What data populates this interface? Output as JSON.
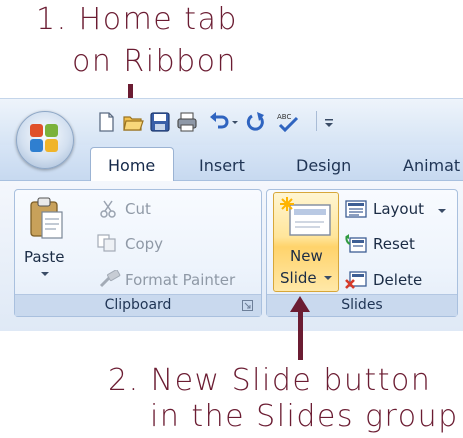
{
  "annotations": {
    "step1_line1": "1. Home tab",
    "step1_line2": "on Ribbon",
    "step2_line1": "2. New Slide button",
    "step2_line2": "in the Slides group"
  },
  "ribbon_tabs": [
    "Home",
    "Insert",
    "Design",
    "Animat"
  ],
  "clipboard_group": {
    "label": "Clipboard",
    "paste": "Paste",
    "cut": "Cut",
    "copy": "Copy",
    "format_painter": "Format Painter"
  },
  "slides_group": {
    "label": "Slides",
    "new_slide_line1": "New",
    "new_slide_line2": "Slide",
    "layout": "Layout",
    "reset": "Reset",
    "delete": "Delete"
  },
  "colors": {
    "annotation": "#6b1c32",
    "highlight": "#ffd36b"
  },
  "icons": [
    "office-button",
    "new-document-icon",
    "open-folder-icon",
    "save-icon",
    "print-icon",
    "undo-icon",
    "redo-icon",
    "spelling-icon",
    "customize-qat-icon",
    "paste-icon",
    "scissors-icon",
    "copy-icon",
    "format-painter-icon",
    "new-slide-icon",
    "layout-icon",
    "reset-icon",
    "delete-slide-icon",
    "dialog-launcher-icon"
  ]
}
